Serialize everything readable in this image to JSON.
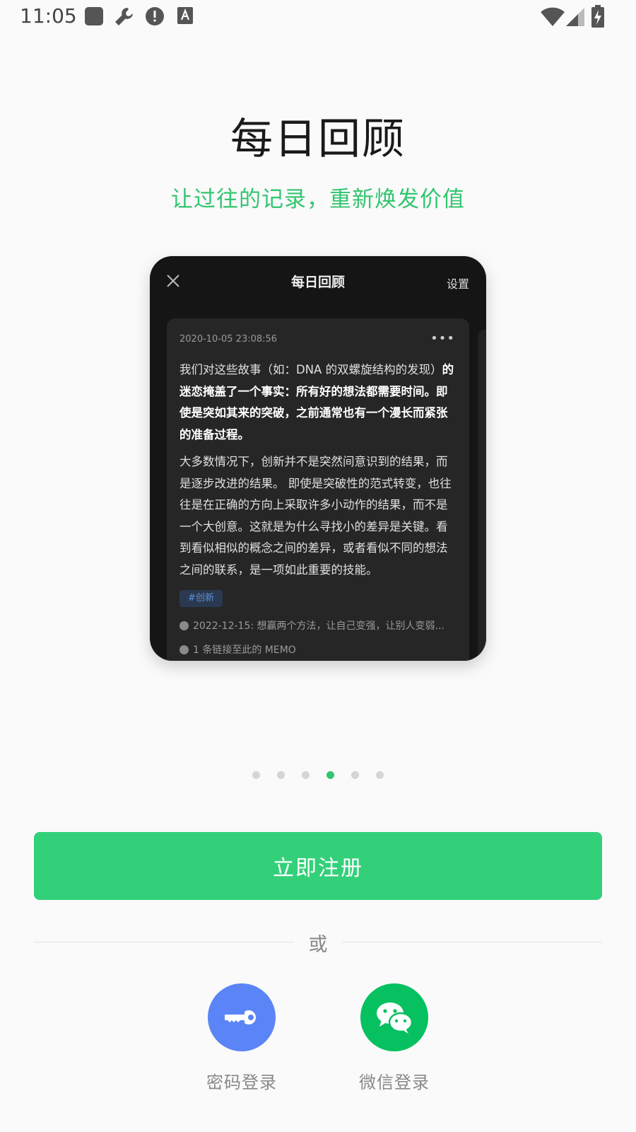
{
  "status_bar": {
    "time": "11:05"
  },
  "intro": {
    "title": "每日回顾",
    "subtitle": "让过往的记录，重新焕发价值"
  },
  "mockup": {
    "header_title": "每日回顾",
    "settings_label": "设置",
    "memo": {
      "date": "2020-10-05 23:08:56",
      "more": "•••",
      "paragraph1_normal": "我们对这些故事（如：DNA 的双螺旋结构的发现）",
      "paragraph1_bold": "的迷恋掩盖了一个事实：所有好的想法都需要时间。即使是突如其来的突破，之前通常也有一个漫长而紧张的准备过程。",
      "paragraph2": "大多数情况下，创新并不是突然间意识到的结果，而是逐步改进的结果。 即使是突破性的范式转变，也往往是在正确的方向上采取许多小动作的结果，而不是一个大创意。这就是为什么寻找小的差异是关键。看到看似相似的概念之间的差异，或者看似不同的想法之间的联系，是一项如此重要的技能。",
      "tag": "#创新",
      "link1": "2022-12-15: 想赢两个方法，让自己变强，让别人变弱...",
      "link2": "1 条链接至此的 MEMO"
    }
  },
  "pager": {
    "count": 6,
    "active_index": 3
  },
  "register_button": "立即注册",
  "divider_text": "或",
  "login_options": {
    "password": {
      "label": "密码登录",
      "icon": "key-icon",
      "color": "#5b84f7"
    },
    "wechat": {
      "label": "微信登录",
      "icon": "wechat-icon",
      "color": "#07c160"
    }
  },
  "colors": {
    "accent": "#33d07a",
    "subtitle": "#33c56f"
  }
}
